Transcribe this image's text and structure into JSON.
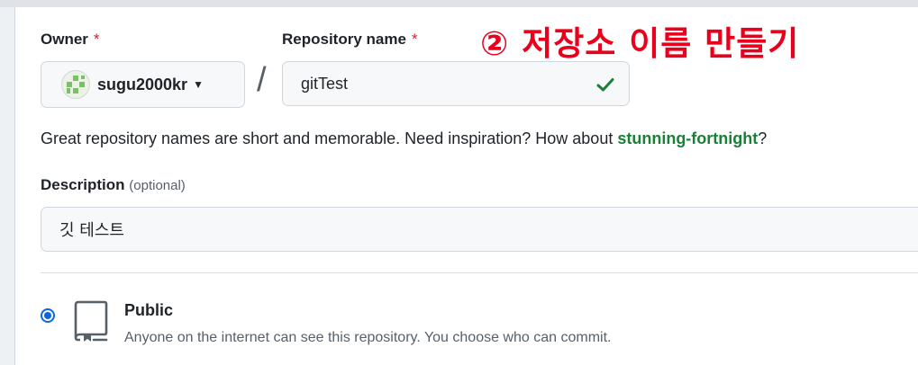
{
  "annotation": "② 저장소 이름 만들기",
  "owner": {
    "label": "Owner",
    "required_mark": "*",
    "selected": "sugu2000kr",
    "avatar_icon": "identicon-avatar",
    "caret_icon": "caret-down-icon"
  },
  "separator": "/",
  "repository": {
    "label": "Repository name",
    "required_mark": "*",
    "value": "gitTest",
    "status_icon": "check-icon",
    "status_color": "#1a7f37"
  },
  "hint": {
    "text": "Great repository names are short and memorable. Need inspiration? How about ",
    "suggestion": "stunning-fortnight",
    "suffix": "?"
  },
  "description": {
    "label": "Description",
    "optional": "(optional)",
    "value": "깃 테스트"
  },
  "visibility": {
    "selected": "public",
    "public_label": "Public",
    "public_desc": "Anyone on the internet can see this repository. You choose who can commit.",
    "public_icon": "repo-icon",
    "accent_color": "#0969da"
  }
}
